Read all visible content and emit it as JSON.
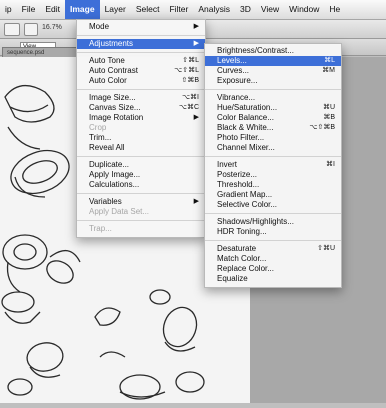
{
  "menubar": {
    "items": [
      "ip",
      "File",
      "Edit",
      "Image",
      "Layer",
      "Select",
      "Filter",
      "Analysis",
      "3D",
      "View",
      "Window",
      "He"
    ],
    "active_index": 3
  },
  "toolbar": {
    "zoom": "16.7%"
  },
  "modebar": {
    "field": "View",
    "tab": "sequence.psd"
  },
  "image_menu": {
    "items": [
      {
        "label": "Mode",
        "shortcut": "",
        "submenu": true
      },
      {
        "sep": true
      },
      {
        "label": "Adjustments",
        "shortcut": "",
        "submenu": true,
        "selected": true
      },
      {
        "sep": true
      },
      {
        "label": "Auto Tone",
        "shortcut": "⇧⌘L"
      },
      {
        "label": "Auto Contrast",
        "shortcut": "⌥⇧⌘L"
      },
      {
        "label": "Auto Color",
        "shortcut": "⇧⌘B"
      },
      {
        "sep": true
      },
      {
        "label": "Image Size...",
        "shortcut": "⌥⌘I"
      },
      {
        "label": "Canvas Size...",
        "shortcut": "⌥⌘C"
      },
      {
        "label": "Image Rotation",
        "shortcut": "",
        "submenu": true
      },
      {
        "label": "Crop",
        "shortcut": "",
        "disabled": true
      },
      {
        "label": "Trim...",
        "shortcut": ""
      },
      {
        "label": "Reveal All",
        "shortcut": ""
      },
      {
        "sep": true
      },
      {
        "label": "Duplicate...",
        "shortcut": ""
      },
      {
        "label": "Apply Image...",
        "shortcut": ""
      },
      {
        "label": "Calculations...",
        "shortcut": ""
      },
      {
        "sep": true
      },
      {
        "label": "Variables",
        "shortcut": "",
        "submenu": true
      },
      {
        "label": "Apply Data Set...",
        "shortcut": "",
        "disabled": true
      },
      {
        "sep": true
      },
      {
        "label": "Trap...",
        "shortcut": "",
        "disabled": true
      }
    ]
  },
  "adjustments_menu": {
    "items": [
      {
        "label": "Brightness/Contrast...",
        "shortcut": ""
      },
      {
        "label": "Levels...",
        "shortcut": "⌘L",
        "selected": true
      },
      {
        "label": "Curves...",
        "shortcut": "⌘M"
      },
      {
        "label": "Exposure...",
        "shortcut": ""
      },
      {
        "sep": true
      },
      {
        "label": "Vibrance...",
        "shortcut": ""
      },
      {
        "label": "Hue/Saturation...",
        "shortcut": "⌘U"
      },
      {
        "label": "Color Balance...",
        "shortcut": "⌘B"
      },
      {
        "label": "Black & White...",
        "shortcut": "⌥⇧⌘B"
      },
      {
        "label": "Photo Filter...",
        "shortcut": ""
      },
      {
        "label": "Channel Mixer...",
        "shortcut": ""
      },
      {
        "sep": true
      },
      {
        "label": "Invert",
        "shortcut": "⌘I"
      },
      {
        "label": "Posterize...",
        "shortcut": ""
      },
      {
        "label": "Threshold...",
        "shortcut": ""
      },
      {
        "label": "Gradient Map...",
        "shortcut": ""
      },
      {
        "label": "Selective Color...",
        "shortcut": ""
      },
      {
        "sep": true
      },
      {
        "label": "Shadows/Highlights...",
        "shortcut": ""
      },
      {
        "label": "HDR Toning...",
        "shortcut": ""
      },
      {
        "sep": true
      },
      {
        "label": "Desaturate",
        "shortcut": "⇧⌘U"
      },
      {
        "label": "Match Color...",
        "shortcut": ""
      },
      {
        "label": "Replace Color...",
        "shortcut": ""
      },
      {
        "label": "Equalize",
        "shortcut": ""
      }
    ]
  },
  "colors": {
    "accent": "#3d6fd8"
  }
}
